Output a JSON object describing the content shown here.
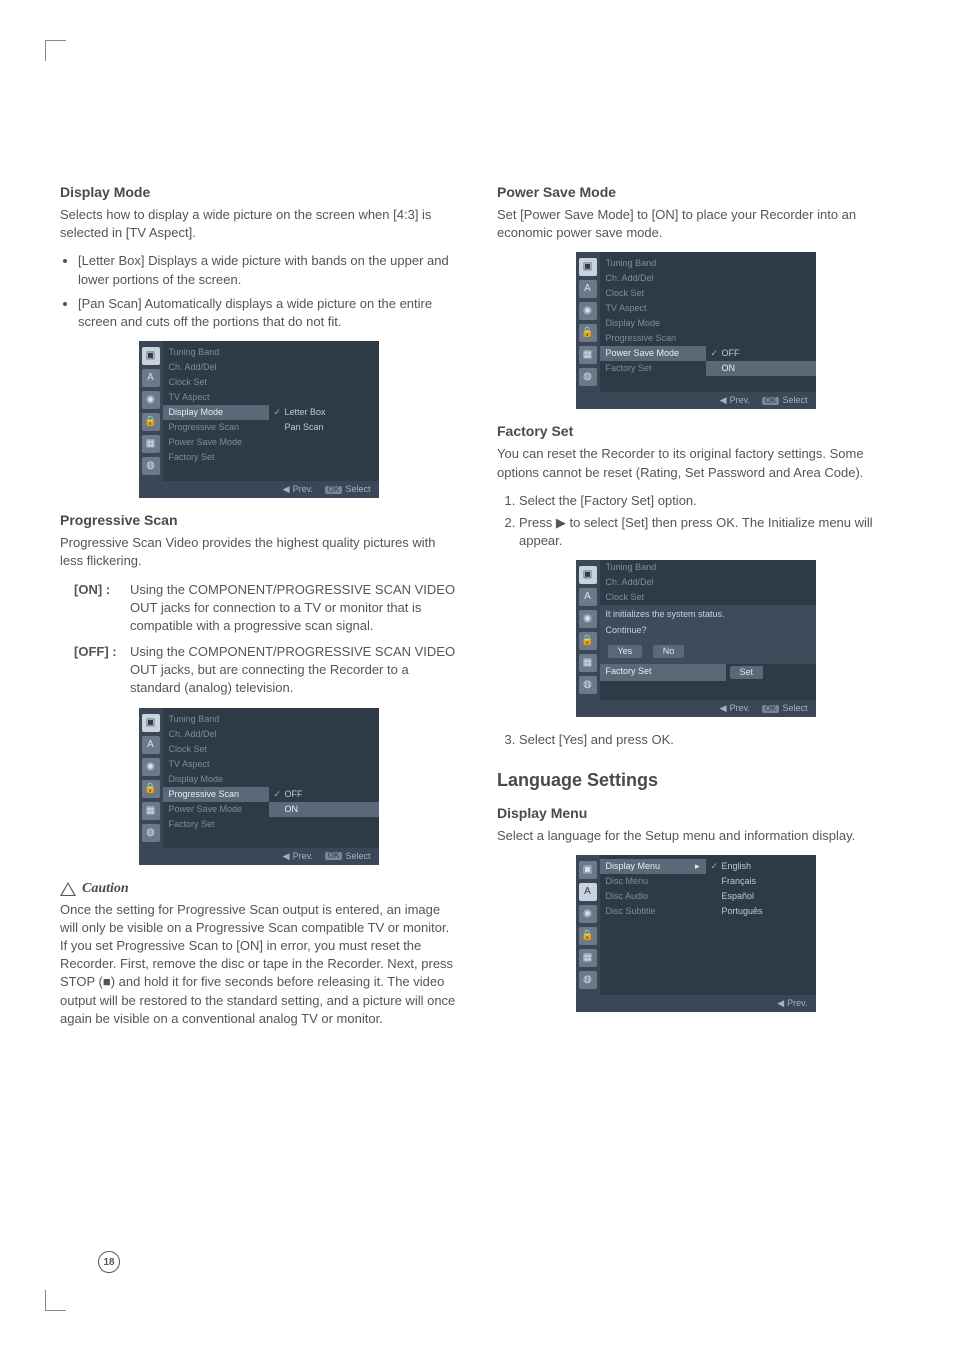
{
  "left": {
    "display_mode": {
      "title": "Display Mode",
      "intro": "Selects how to display a wide picture on the screen when [4:3] is selected in [TV Aspect].",
      "bullets": [
        "[Letter Box] Displays a wide picture with bands on the upper and lower portions of the screen.",
        "[Pan Scan] Automatically displays a wide picture on the entire screen and cuts off the portions that do not fit."
      ],
      "osd": {
        "menu": [
          "Tuning Band",
          "Ch. Add/Del",
          "Clock Set",
          "TV Aspect",
          "Display Mode",
          "Progressive Scan",
          "Power Save Mode",
          "Factory Set"
        ],
        "hi_index": 4,
        "opts": [
          {
            "label": "Letter Box",
            "sel": true
          },
          {
            "label": "Pan Scan"
          }
        ],
        "footer_prev": "Prev.",
        "footer_select": "Select",
        "footer_ok": "OK"
      }
    },
    "progressive_scan": {
      "title": "Progressive Scan",
      "intro": "Progressive Scan Video provides the highest quality pictures with less flickering.",
      "on_label": "[ON] :",
      "on_text": "Using the COMPONENT/PROGRESSIVE SCAN VIDEO OUT jacks for connection to a TV or monitor that is compatible with a progressive scan signal.",
      "off_label": "[OFF] :",
      "off_text": "Using the COMPONENT/PROGRESSIVE SCAN VIDEO OUT jacks, but are connecting the Recorder to a standard (analog) television.",
      "osd": {
        "menu": [
          "Tuning Band",
          "Ch. Add/Del",
          "Clock Set",
          "TV Aspect",
          "Display Mode",
          "Progressive Scan",
          "Power Save Mode",
          "Factory Set"
        ],
        "hi_index": 5,
        "opts": [
          {
            "label": "OFF",
            "sel": true
          },
          {
            "label": "ON",
            "hi": true
          }
        ],
        "footer_prev": "Prev.",
        "footer_select": "Select",
        "footer_ok": "OK"
      }
    },
    "caution": {
      "label": "Caution",
      "text": "Once the setting for Progressive Scan output is entered, an image will only be visible on a Progressive Scan compatible TV or monitor. If you set Progressive Scan to [ON] in error, you must reset the Recorder. First, remove the disc or tape in the Recorder. Next, press STOP (■) and hold it for five seconds before releasing it. The video output will be restored to the standard setting, and a picture will once again be visible on a conventional analog TV or monitor."
    }
  },
  "right": {
    "power_save": {
      "title": "Power Save Mode",
      "intro": "Set [Power Save Mode] to [ON] to place your Recorder into an economic power save mode.",
      "osd": {
        "menu": [
          "Tuning Band",
          "Ch. Add/Del",
          "Clock Set",
          "TV Aspect",
          "Display Mode",
          "Progressive Scan",
          "Power Save Mode",
          "Factory Set"
        ],
        "hi_index": 6,
        "opts": [
          {
            "label": "OFF",
            "sel": true
          },
          {
            "label": "ON",
            "hi": true
          }
        ],
        "footer_prev": "Prev.",
        "footer_select": "Select",
        "footer_ok": "OK"
      }
    },
    "factory_set": {
      "title": "Factory Set",
      "intro": "You can reset the Recorder to its original factory settings. Some options cannot be reset (Rating, Set Password and Area Code).",
      "steps": [
        "Select the [Factory Set] option.",
        "Press ▶ to select [Set] then press OK. The Initialize menu will appear."
      ],
      "osd": {
        "menu_top": [
          "Tuning Band",
          "Ch. Add/Del",
          "Clock Set"
        ],
        "msg_line1": "It initializes the system status.",
        "msg_line2": "Continue?",
        "btn_yes": "Yes",
        "btn_no": "No",
        "hi_label": "Factory Set",
        "btn_set": "Set",
        "footer_prev": "Prev.",
        "footer_select": "Select",
        "footer_ok": "OK"
      },
      "step3": "Select [Yes] and press OK."
    },
    "language": {
      "section_title": "Language Settings",
      "sub_title": "Display Menu",
      "intro": "Select a language for the Setup menu and information display.",
      "osd": {
        "menu": [
          "Display Menu",
          "Disc Menu",
          "Disc Audio",
          "Disc Subtitle"
        ],
        "hi_index": 0,
        "opts": [
          {
            "label": "English",
            "sel": true
          },
          {
            "label": "Français"
          },
          {
            "label": "Español"
          },
          {
            "label": "Português"
          }
        ],
        "footer_prev": "Prev."
      }
    }
  },
  "icons": [
    "▣",
    "A",
    "◉",
    "🔒",
    "▦",
    "◍"
  ],
  "page_number": "18"
}
